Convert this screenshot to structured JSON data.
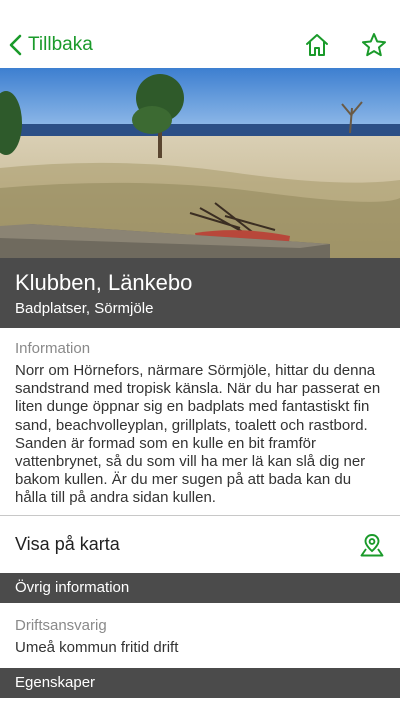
{
  "nav": {
    "back_label": "Tillbaka",
    "accent": "#1a9a2a",
    "home_icon": "home-icon",
    "favorite_icon": "star-icon"
  },
  "place": {
    "title": "Klubben, Länkebo",
    "subtitle": "Badplatser, Sörmjöle"
  },
  "information": {
    "label": "Information",
    "text": "Norr om Hörnefors, närmare Sörmjöle, hittar du denna sandstrand med tropisk känsla. När du har passerat en liten dunge öppnar sig en badplats med fantastiskt fin sand, beachvolleyplan, grillplats, toalett och rastbord. Sanden är formad som en kulle en bit framför vattenbrynet, så du som vill ha mer lä kan slå dig ner bakom kullen. Är du mer sugen på att bada kan du hålla till på andra sidan kullen."
  },
  "map": {
    "label": "Visa på karta",
    "icon": "map-pin-icon"
  },
  "other_info": {
    "header": "Övrig information",
    "fields": [
      {
        "label": "Driftsansvarig",
        "value": "Umeå kommun fritid drift"
      }
    ]
  },
  "properties": {
    "header": "Egenskaper"
  },
  "colors": {
    "band": "#4b4b4b",
    "muted_label": "#8a8a8a"
  }
}
